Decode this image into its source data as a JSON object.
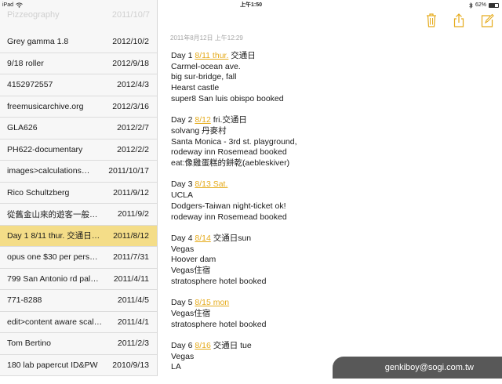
{
  "status_bar": {
    "device": "iPad",
    "time": "上午1:50",
    "battery": "62%",
    "battery_level": 0.62
  },
  "sidebar": {
    "header_ghost": {
      "title": "Pizzeography",
      "date": "2011/10/7"
    },
    "notes": [
      {
        "title": "Grey gamma 1.8",
        "date": "2012/10/2"
      },
      {
        "title": "9/18 roller",
        "date": "2012/9/18"
      },
      {
        "title": "4152972557",
        "date": "2012/4/3"
      },
      {
        "title": "freemusicarchive.org",
        "date": "2012/3/16"
      },
      {
        "title": "GLA626",
        "date": "2012/2/7"
      },
      {
        "title": "PH622-documentary",
        "date": "2012/2/2"
      },
      {
        "title": "images>calculations…",
        "date": "2011/10/17"
      },
      {
        "title": "Rico Schultzberg",
        "date": "2011/9/12"
      },
      {
        "title": "從舊金山來的遊客一般會…",
        "date": "2011/9/2"
      },
      {
        "title": "Day 1 8/11 thur. 交通日…",
        "date": "2011/8/12",
        "selected": true
      },
      {
        "title": "opus one $30 per pers…",
        "date": "2011/7/31"
      },
      {
        "title": "799 San Antonio rd pal…",
        "date": "2011/4/11"
      },
      {
        "title": "771-8288",
        "date": "2011/4/5"
      },
      {
        "title": "edit>content aware scal…",
        "date": "2011/4/1"
      },
      {
        "title": "Tom Bertino",
        "date": "2011/2/3"
      },
      {
        "title": "180 lab papercut ID&PW",
        "date": "2010/9/13"
      }
    ]
  },
  "toolbar": {
    "icons": [
      "trash-icon",
      "share-icon",
      "compose-icon"
    ],
    "accent_color": "#e5aa1a"
  },
  "note": {
    "timestamp": "2011年8月12日 上午12:29",
    "paragraphs": [
      {
        "lines": [
          {
            "pre": "Day 1 ",
            "link": "8/11 thur.",
            "post": " 交通日"
          },
          {
            "pre": "Carmel-ocean ave."
          },
          {
            "pre": "big sur-bridge, fall"
          },
          {
            "pre": "Hearst castle"
          },
          {
            "pre": "super8 San luis obispo booked"
          }
        ]
      },
      {
        "lines": [
          {
            "pre": "Day 2 ",
            "link": "8/12",
            "post": " fri.交通日"
          },
          {
            "pre": "solvang 丹麥村"
          },
          {
            "pre": "Santa Monica - 3rd st. playground,"
          },
          {
            "pre": "rodeway inn Rosemead booked"
          },
          {
            "pre": "eat:像雞蛋糕的餅乾(aebleskiver)"
          }
        ]
      },
      {
        "lines": [
          {
            "pre": "Day 3 ",
            "link": "8/13 Sat."
          },
          {
            "pre": "UCLA"
          },
          {
            "pre": "Dodgers-Taiwan night-ticket ok!"
          },
          {
            "pre": "rodeway inn Rosemead booked"
          }
        ]
      },
      {
        "lines": [
          {
            "pre": "Day 4 ",
            "link": "8/14",
            "post": " 交通日sun"
          },
          {
            "pre": "Vegas"
          },
          {
            "pre": "Hoover dam"
          },
          {
            "pre": "Vegas住宿"
          },
          {
            "pre": "stratosphere hotel booked"
          }
        ]
      },
      {
        "lines": [
          {
            "pre": "Day 5 ",
            "link": "8/15 mon"
          },
          {
            "pre": "Vegas住宿"
          },
          {
            "pre": "stratosphere hotel booked"
          }
        ]
      },
      {
        "lines": [
          {
            "pre": "Day 6 ",
            "link": "8/16",
            "post": " 交通日 tue"
          },
          {
            "pre": "Vegas"
          },
          {
            "pre": "LA"
          }
        ]
      }
    ]
  },
  "watermark": "genkiboy@sogi.com.tw"
}
